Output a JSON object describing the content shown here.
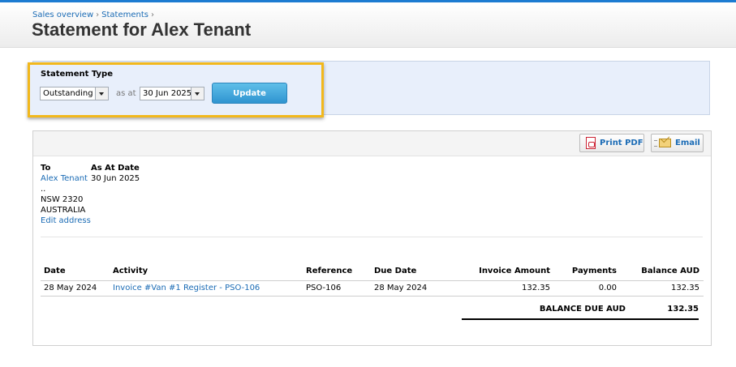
{
  "breadcrumb": {
    "items": [
      "Sales overview",
      "Statements"
    ],
    "separator": "›"
  },
  "page_title": "Statement for Alex Tenant",
  "filter": {
    "statement_type_label": "Statement Type",
    "statement_type_value": "Outstanding",
    "as_at_label": "as at",
    "date_value": "30 Jun 2025",
    "update_label": "Update"
  },
  "toolbar": {
    "print_pdf_label": "Print PDF",
    "email_label": "Email"
  },
  "address": {
    "to_label": "To",
    "name": "Alex Tenant",
    "line1": "..",
    "line2": "NSW 2320",
    "line3": "AUSTRALIA",
    "edit_label": "Edit address"
  },
  "as_at_date": {
    "label": "As At Date",
    "value": "30 Jun 2025"
  },
  "table": {
    "headers": [
      "Date",
      "Activity",
      "Reference",
      "Due Date",
      "Invoice Amount",
      "Payments",
      "Balance AUD"
    ],
    "rows": [
      [
        "28 May 2024",
        "Invoice #Van #1 Register - PSO-106",
        "PSO-106",
        "28 May 2024",
        "132.35",
        "0.00",
        "132.35"
      ]
    ]
  },
  "total": {
    "label": "BALANCE DUE AUD",
    "value": "132.35"
  },
  "colors": {
    "accent": "#1c7bd1",
    "link": "#1a6bb5",
    "highlight": "#f2b81c",
    "panel": "#e8effb"
  }
}
